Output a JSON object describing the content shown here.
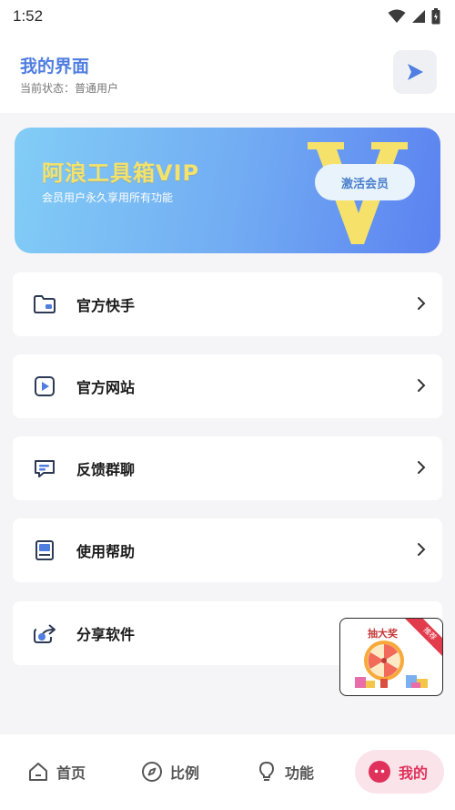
{
  "status_bar": {
    "time": "1:52"
  },
  "header": {
    "title": "我的界面",
    "status": "当前状态：普通用户"
  },
  "vip": {
    "title": "阿浪工具箱VIP",
    "subtitle": "会员用户永久享用所有功能",
    "activate_label": "激活会员",
    "colors": {
      "gradient_start": "#82cdf6",
      "gradient_end": "#5b82f0",
      "title_color": "#f3e26b"
    }
  },
  "menu": [
    {
      "label": "官方快手",
      "icon": "folder-icon"
    },
    {
      "label": "官方网站",
      "icon": "play-box-icon"
    },
    {
      "label": "反馈群聊",
      "icon": "chat-icon"
    },
    {
      "label": "使用帮助",
      "icon": "book-icon"
    },
    {
      "label": "分享软件",
      "icon": "share-icon"
    }
  ],
  "prize": {
    "title": "抽大奖",
    "tag": "推荐"
  },
  "nav": [
    {
      "label": "首页",
      "icon": "home-icon"
    },
    {
      "label": "比例",
      "icon": "compass-icon"
    },
    {
      "label": "功能",
      "icon": "bulb-icon"
    },
    {
      "label": "我的",
      "icon": "profile-icon",
      "active": true
    }
  ],
  "colors": {
    "accent": "#4f7de0",
    "active_nav": "#e0315b"
  }
}
